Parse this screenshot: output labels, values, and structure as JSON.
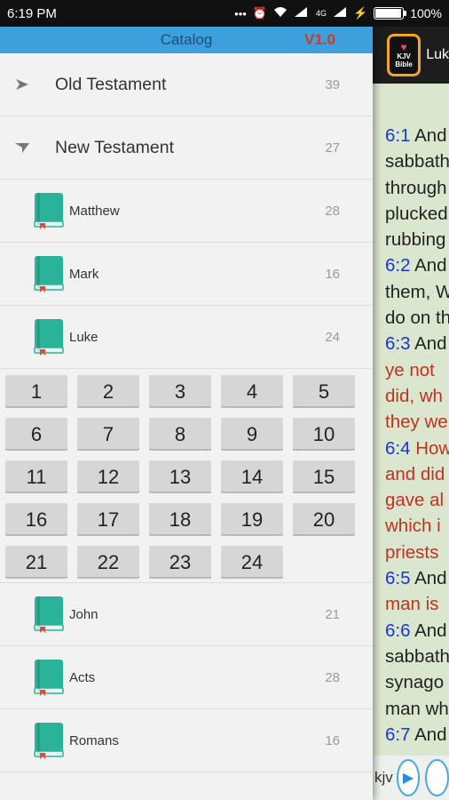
{
  "status_bar": {
    "time": "6:19 PM",
    "signal_text": "4G",
    "battery_text": "100%",
    "battery_level": 1.0
  },
  "drawer": {
    "title": "Catalog",
    "version": "V1.0",
    "testaments": [
      {
        "label": "Old Testament",
        "count": "39",
        "expanded": false
      },
      {
        "label": "New Testament",
        "count": "27",
        "expanded": true
      }
    ],
    "books_before": [
      {
        "label": "Matthew",
        "count": "28"
      },
      {
        "label": "Mark",
        "count": "16"
      },
      {
        "label": "Luke",
        "count": "24"
      }
    ],
    "chapters": [
      "1",
      "2",
      "3",
      "4",
      "5",
      "6",
      "7",
      "8",
      "9",
      "10",
      "11",
      "12",
      "13",
      "14",
      "15",
      "16",
      "17",
      "18",
      "19",
      "20",
      "21",
      "22",
      "23",
      "24"
    ],
    "books_after": [
      {
        "label": "John",
        "count": "21"
      },
      {
        "label": "Acts",
        "count": "28"
      },
      {
        "label": "Romans",
        "count": "16"
      }
    ],
    "book_icon_color": "#2bb39a",
    "bookmark_color": "#e04b3a"
  },
  "reader": {
    "title": "Luk",
    "logo_text": "Bible",
    "logo_small": "KJV",
    "lines": [
      {
        "num": "6:1",
        "text": " And"
      },
      {
        "text": "sabbath"
      },
      {
        "text": "through"
      },
      {
        "text": "plucked"
      },
      {
        "text": "rubbing"
      },
      {
        "num": "6:2",
        "text": " And"
      },
      {
        "text": "them, W"
      },
      {
        "text": "do on th"
      },
      {
        "num": "6:3",
        "text": " And"
      },
      {
        "text": "ye not",
        "red": true
      },
      {
        "text": "did, wh",
        "red": true
      },
      {
        "text": "they we",
        "red": true
      },
      {
        "num": "6:4",
        "text": " How",
        "red": true
      },
      {
        "text": "and did",
        "red": true
      },
      {
        "text": "gave al",
        "red": true
      },
      {
        "text": "which i",
        "red": true
      },
      {
        "text": "priests",
        "red": true
      },
      {
        "num": "6:5",
        "text": " And"
      },
      {
        "text": "man is",
        "red": true
      },
      {
        "num": "6:6",
        "text": " And"
      },
      {
        "text": "sabbath"
      },
      {
        "text": "synago"
      },
      {
        "text": "man wh"
      },
      {
        "num": "6:7",
        "text": " And"
      }
    ],
    "footer_label": "kjv",
    "accent": "#46a6e6"
  }
}
